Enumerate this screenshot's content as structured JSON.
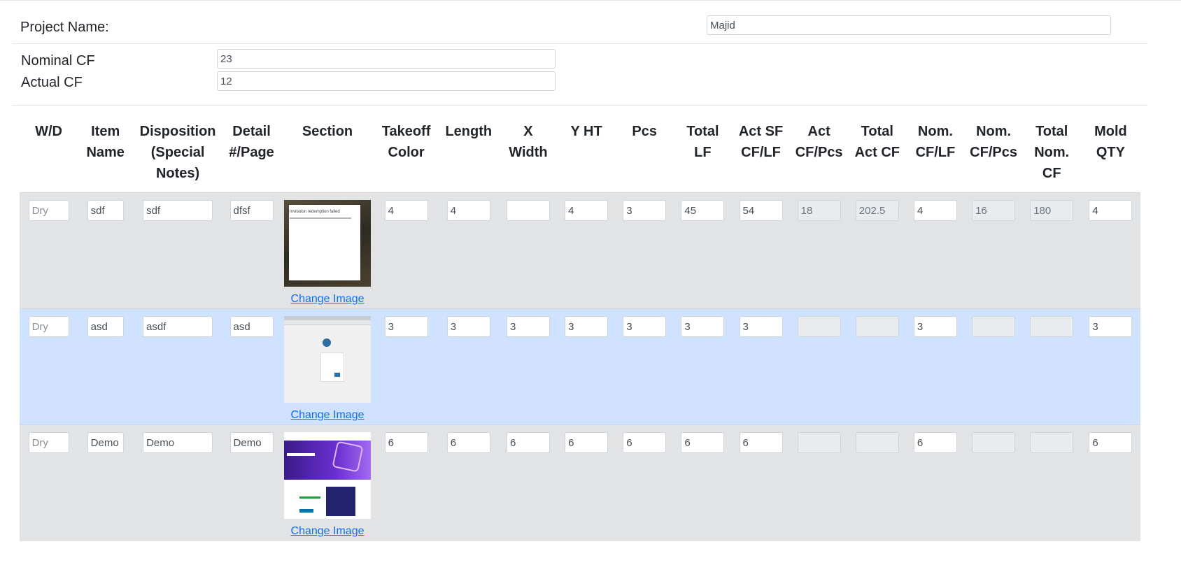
{
  "project": {
    "label": "Project Name:",
    "value": "Majid"
  },
  "cf": {
    "nominal_label": "Nominal CF",
    "nominal_value": "23",
    "actual_label": "Actual CF",
    "actual_value": "12"
  },
  "table": {
    "headers": [
      [
        "W/D"
      ],
      [
        "Item",
        "Name"
      ],
      [
        "Disposition",
        "(Special",
        "Notes)"
      ],
      [
        "Detail",
        "#/Page"
      ],
      [
        "Section"
      ],
      [
        "Takeoff",
        "Color"
      ],
      [
        "Length"
      ],
      [
        "X",
        "Width"
      ],
      [
        "Y HT"
      ],
      [
        "Pcs"
      ],
      [
        "Total",
        "LF"
      ],
      [
        "Act SF",
        "CF/LF"
      ],
      [
        "Act",
        "CF/Pcs"
      ],
      [
        "Total",
        "Act CF"
      ],
      [
        "Nom.",
        "CF/LF"
      ],
      [
        "Nom.",
        "CF/Pcs"
      ],
      [
        "Total",
        "Nom.",
        "CF"
      ],
      [
        "Mold",
        "QTY"
      ]
    ],
    "change_image_label": "Change Image",
    "rows": [
      {
        "wd": "Dry",
        "item_name": "sdf",
        "disposition": "sdf",
        "detail": "dfsf",
        "image_caption": "Invitation redemption failed",
        "takeoff_color": "4",
        "length": "4",
        "x_width": "",
        "y_ht": "4",
        "pcs": "3",
        "total_lf": "45",
        "act_sf_cf_lf": "54",
        "act_cf_pcs": "18",
        "total_act_cf": "202.5",
        "nom_cf_lf": "4",
        "nom_cf_pcs": "16",
        "total_nom_cf": "180",
        "mold_qty": "4"
      },
      {
        "wd": "Dry",
        "item_name": "asd",
        "disposition": "asdf",
        "detail": "asd",
        "takeoff_color": "3",
        "length": "3",
        "x_width": "3",
        "y_ht": "3",
        "pcs": "3",
        "total_lf": "3",
        "act_sf_cf_lf": "3",
        "act_cf_pcs": "",
        "total_act_cf": "",
        "nom_cf_lf": "3",
        "nom_cf_pcs": "",
        "total_nom_cf": "",
        "mold_qty": "3"
      },
      {
        "wd": "Dry",
        "item_name": "Demo",
        "disposition": "Demo",
        "detail": "Demo",
        "takeoff_color": "6",
        "length": "6",
        "x_width": "6",
        "y_ht": "6",
        "pcs": "6",
        "total_lf": "6",
        "act_sf_cf_lf": "6",
        "act_cf_pcs": "",
        "total_act_cf": "",
        "nom_cf_lf": "6",
        "nom_cf_pcs": "",
        "total_nom_cf": "",
        "mold_qty": "6"
      }
    ]
  },
  "colors": {
    "row_gray": "#e2e3e5",
    "row_selected": "#cfe2ff",
    "link": "#0d6efd"
  }
}
